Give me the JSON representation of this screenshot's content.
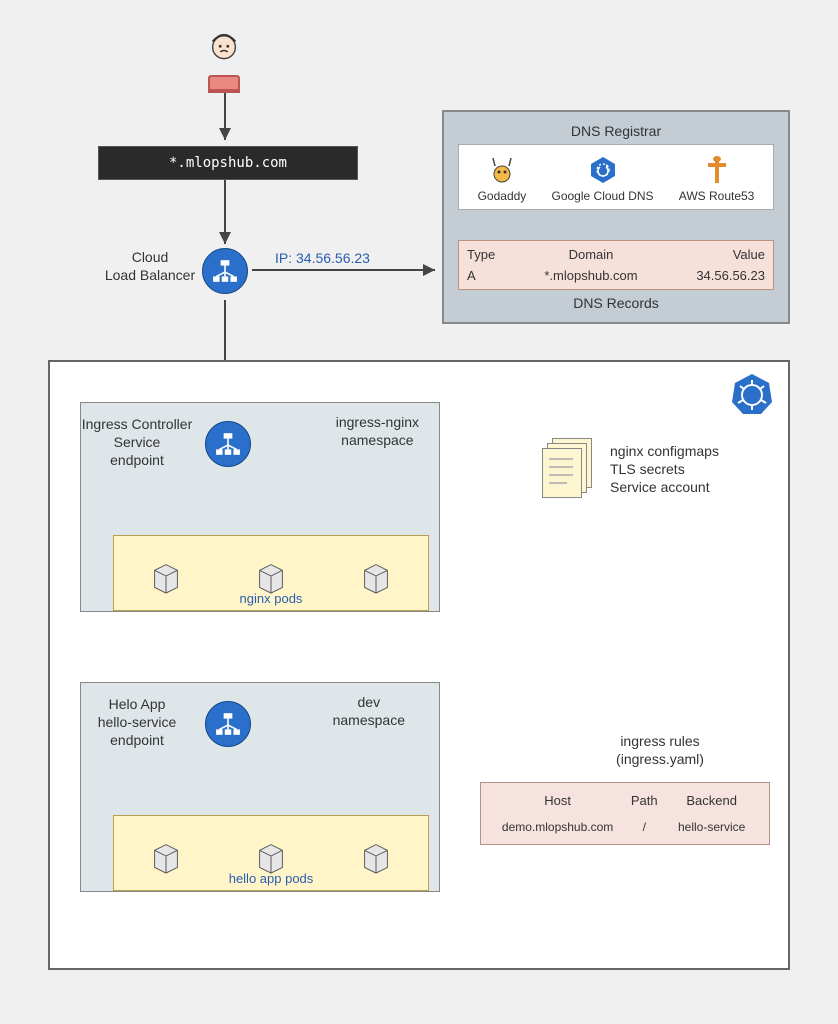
{
  "user_domain": "*.mlopshub.com",
  "lb_label": "Cloud\nLoad Balancer",
  "lb_ip_label": "IP: 34.56.56.23",
  "dns_panel": {
    "title": "DNS Registrar",
    "registrars": {
      "godaddy": "Godaddy",
      "gcloud": "Google Cloud DNS",
      "route53": "AWS Route53"
    },
    "records_title": "DNS Records",
    "headers": {
      "type": "Type",
      "domain": "Domain",
      "value": "Value"
    },
    "row": {
      "type": "A",
      "domain": "*.mlopshub.com",
      "value": "34.56.56.23"
    }
  },
  "ns_ingress": {
    "label": "ingress-nginx\nnamespace",
    "svc_label": "Ingress Controller\nService\nendpoint",
    "pods_label": "nginx pods"
  },
  "ns_dev": {
    "label": "dev\nnamespace",
    "svc_label": "Helo App\nhello-service\nendpoint",
    "pods_label": "hello app pods"
  },
  "config_label": "nginx configmaps\nTLS secrets\nService account",
  "ingress_rules": {
    "title": "ingress rules\n(ingress.yaml)",
    "headers": {
      "host": "Host",
      "path": "Path",
      "backend": "Backend"
    },
    "row": {
      "host": "demo.mlopshub.com",
      "path": "/",
      "backend": "hello-service"
    }
  }
}
